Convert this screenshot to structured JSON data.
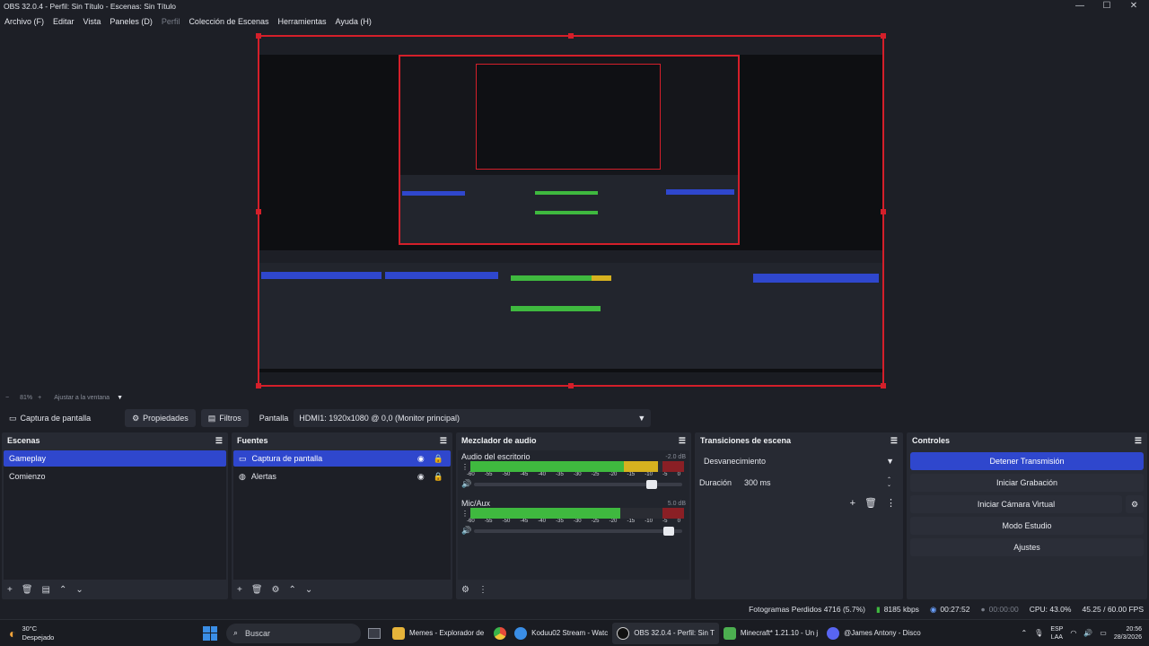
{
  "window": {
    "title": "OBS 32.0.4 - Perfil: Sin Título - Escenas: Sin Título",
    "minimize": "—",
    "maximize": "☐",
    "close": "✕"
  },
  "menu": [
    "Archivo (F)",
    "Editar",
    "Vista",
    "Paneles (D)",
    "Perfil",
    "Colección de Escenas",
    "Herramientas",
    "Ayuda (H)"
  ],
  "zoom": {
    "level": "81%",
    "fit_label": "Ajustar a la ventana"
  },
  "source_toolbar": {
    "source_name": "Captura de pantalla",
    "properties": "Propiedades",
    "filters": "Filtros",
    "display_label": "Pantalla",
    "display_value": "HDMI1: 1920x1080 @ 0,0 (Monitor principal)"
  },
  "scenes": {
    "title": "Escenas",
    "items": [
      "Gameplay",
      "Comienzo"
    ],
    "selected": 0
  },
  "sources": {
    "title": "Fuentes",
    "items": [
      "Captura de pantalla",
      "Alertas"
    ],
    "selected": 0
  },
  "mixer": {
    "title": "Mezclador de audio",
    "channels": [
      {
        "name": "Audio del escritorio",
        "db": "-2.0 dB",
        "level": 0.88,
        "slider": 0.88
      },
      {
        "name": "Mic/Aux",
        "db": "5.0 dB",
        "level": 0.7,
        "slider": 0.96
      }
    ],
    "ticks": [
      "-60",
      "-55",
      "-50",
      "-45",
      "-40",
      "-35",
      "-30",
      "-25",
      "-20",
      "-15",
      "-10",
      "-5",
      "0"
    ]
  },
  "transitions": {
    "title": "Transiciones de escena",
    "selected": "Desvanecimiento",
    "duration_label": "Duración",
    "duration_value": "300 ms"
  },
  "controls": {
    "title": "Controles",
    "buttons": [
      "Detener Transmisión",
      "Iniciar Grabación",
      "Iniciar Cámara Virtual",
      "Modo Estudio",
      "Ajustes"
    ]
  },
  "status": {
    "dropped": "Fotogramas Perdidos 4716 (5.7%)",
    "bitrate": "8185 kbps",
    "stream_time": "00:27:52",
    "rec_time": "00:00:00",
    "cpu": "CPU: 43.0%",
    "fps": "45.25 / 60.00 FPS"
  },
  "taskbar": {
    "weather_temp": "30°C",
    "weather_desc": "Despejado",
    "search": "Buscar",
    "apps": [
      "Memes - Explorador de",
      "Koduu02 Stream - Watc",
      "OBS 32.0.4 - Perfil: Sin T",
      "Minecraft* 1.21.10 - Un j",
      "@James Antony - Disco"
    ],
    "lang_top": "ESP",
    "lang_bottom": "LAA",
    "time": "20:56",
    "date": "28/3/2026"
  },
  "colors": {
    "accent": "#2f47cd",
    "capture_border": "#d41f2a",
    "meter_green": "#3fb93f",
    "meter_yellow": "#d6b11f",
    "meter_red": "#8a1f25"
  }
}
